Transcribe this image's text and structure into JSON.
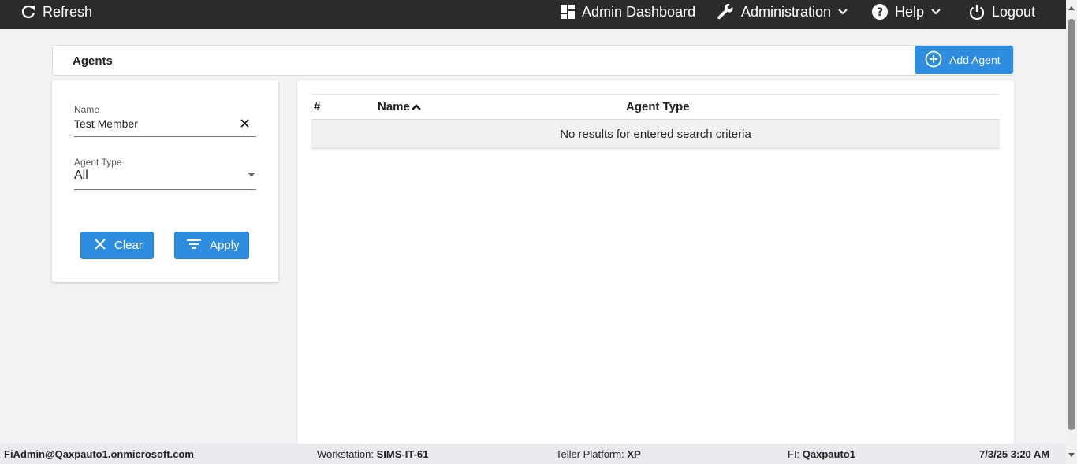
{
  "topbar": {
    "refresh_label": "Refresh",
    "dashboard_label": "Admin Dashboard",
    "administration_label": "Administration",
    "help_label": "Help",
    "logout_label": "Logout"
  },
  "header": {
    "title": "Agents",
    "add_button_label": "Add Agent"
  },
  "filters": {
    "name_label": "Name",
    "name_value": "Test Member",
    "agent_type_label": "Agent Type",
    "agent_type_value": "All",
    "clear_label": "Clear",
    "apply_label": "Apply"
  },
  "table": {
    "columns": [
      "#",
      "Name",
      "Agent Type"
    ],
    "empty_message": "No results for entered search criteria"
  },
  "status": {
    "user": "FiAdmin@Qaxpauto1.onmicrosoft.com",
    "workstation_label": "Workstation:",
    "workstation_value": "SIMS-IT-61",
    "teller_label": "Teller Platform:",
    "teller_value": "XP",
    "fi_label": "FI:",
    "fi_value": "Qaxpauto1",
    "datetime": "7/3/25 3:20 AM"
  },
  "colors": {
    "accent": "#2f8de0",
    "topbar": "#2b2b2b"
  }
}
